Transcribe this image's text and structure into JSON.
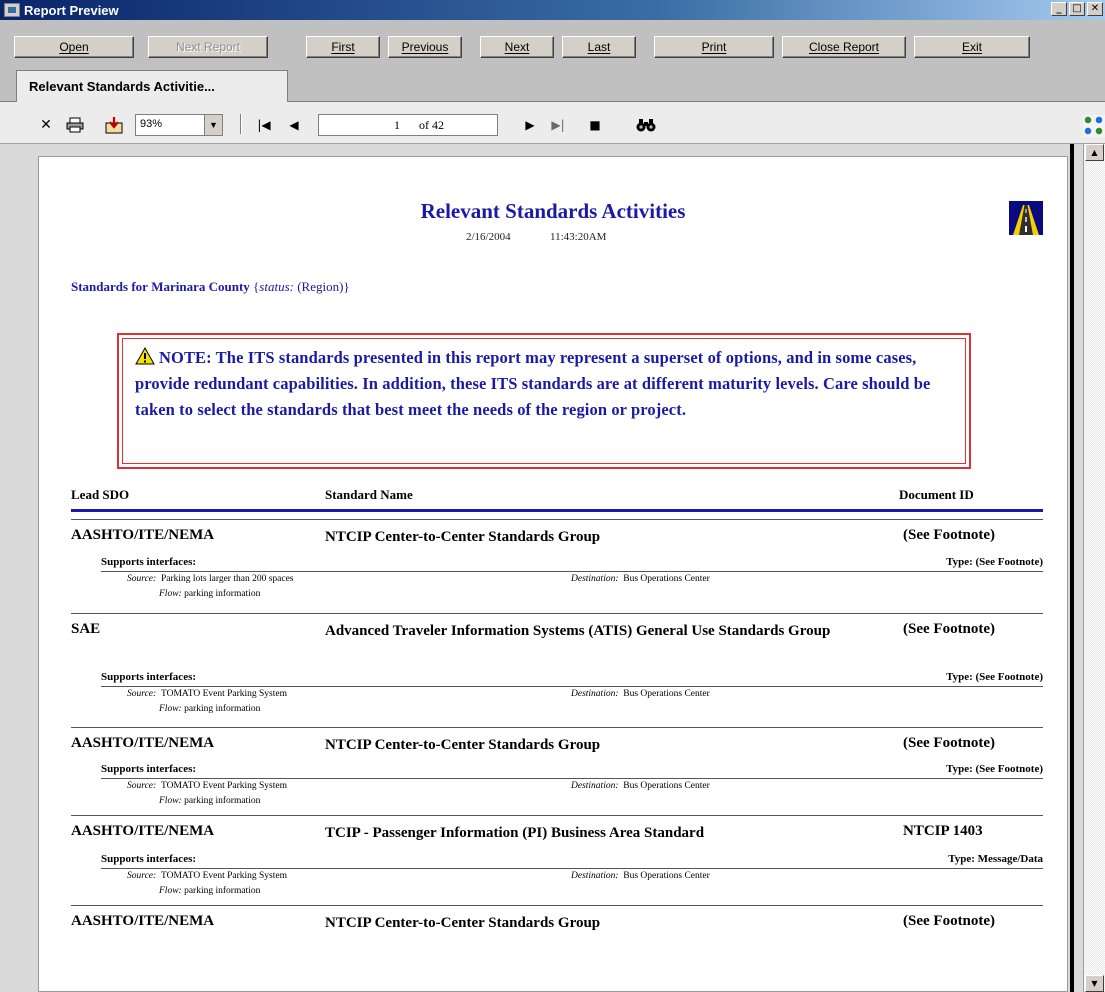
{
  "window": {
    "title": "Report Preview"
  },
  "command_bar": {
    "open": "Open",
    "next_report": "Next Report",
    "first": "First",
    "previous": "Previous",
    "next": "Next",
    "last": "Last",
    "print": "Print",
    "close_report": "Close Report",
    "exit": "Exit"
  },
  "tab": {
    "label": "Relevant Standards Activitie..."
  },
  "viewer": {
    "zoom": "93%",
    "page_number": "1",
    "page_total": "of 42"
  },
  "report": {
    "title": "Relevant Standards Activities",
    "date": "2/16/2004",
    "time": "11:43:20AM",
    "region_prefix": "Standards for",
    "region_name": "Marinara County",
    "status_open": "{",
    "status_label": "status:",
    "status_value": "(Region)}",
    "note": "NOTE: The ITS standards presented in this report may represent a superset of options, and in some cases, provide redundant capabilities.  In addition, these ITS standards are at different maturity levels.  Care should be taken to select the standards that best meet the needs of the region or project.",
    "columns": {
      "lead_sdo": "Lead SDO",
      "standard_name": "Standard Name",
      "document_id": "Document ID"
    },
    "labels": {
      "supports": "Supports interfaces:",
      "source": "Source:",
      "destination": "Destination:",
      "flow": "Flow:"
    },
    "rows": [
      {
        "sdo": "AASHTO/ITE/NEMA",
        "name": "NTCIP Center-to-Center Standards Group",
        "doc": "(See Footnote)",
        "type": "Type: (See Footnote)",
        "source": "Parking lots larger than 200 spaces",
        "destination": "Bus Operations Center",
        "flow": "parking information"
      },
      {
        "sdo": "SAE",
        "name": "Advanced Traveler Information Systems (ATIS) General Use Standards Group",
        "doc": "(See Footnote)",
        "type": "Type: (See Footnote)",
        "source": "TOMATO Event Parking System",
        "destination": "Bus Operations Center",
        "flow": "parking information"
      },
      {
        "sdo": "AASHTO/ITE/NEMA",
        "name": "NTCIP Center-to-Center Standards Group",
        "doc": "(See Footnote)",
        "type": "Type: (See Footnote)",
        "source": "TOMATO Event Parking System",
        "destination": "Bus Operations Center",
        "flow": "parking information"
      },
      {
        "sdo": "AASHTO/ITE/NEMA",
        "name": "TCIP - Passenger Information (PI) Business Area Standard",
        "doc": "NTCIP 1403",
        "type": "Type: Message/Data",
        "source": "TOMATO Event Parking System",
        "destination": "Bus Operations Center",
        "flow": "parking information"
      },
      {
        "sdo": "AASHTO/ITE/NEMA",
        "name": "NTCIP Center-to-Center Standards Group",
        "doc": "(See Footnote)"
      }
    ]
  }
}
